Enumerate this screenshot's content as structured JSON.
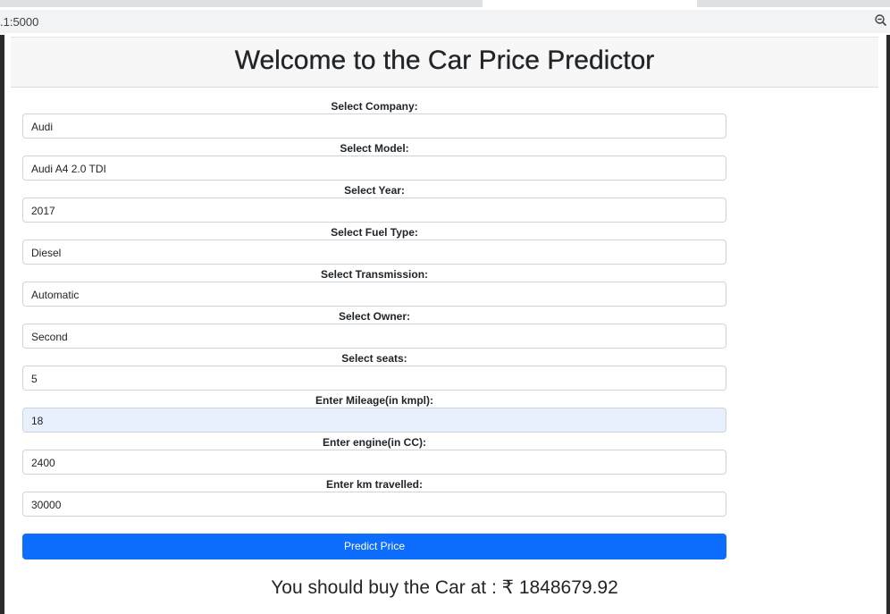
{
  "browser": {
    "url": ".1:5000",
    "zoom_icon": "zoom-out-icon"
  },
  "page": {
    "title": "Welcome to the Car Price Predictor"
  },
  "form": {
    "fields": [
      {
        "label": "Select Company:",
        "value": "Audi"
      },
      {
        "label": "Select Model:",
        "value": "Audi A4 2.0 TDI"
      },
      {
        "label": "Select Year:",
        "value": "2017"
      },
      {
        "label": "Select Fuel Type:",
        "value": "Diesel"
      },
      {
        "label": "Select Transmission:",
        "value": "Automatic"
      },
      {
        "label": "Select Owner:",
        "value": "Second"
      },
      {
        "label": "Select seats:",
        "value": "5"
      },
      {
        "label": "Enter Mileage(in kmpl):",
        "value": "18"
      },
      {
        "label": "Enter engine(in CC):",
        "value": "2400"
      },
      {
        "label": "Enter km travelled:",
        "value": "30000"
      }
    ],
    "submit_label": "Predict Price"
  },
  "result": {
    "text": "You should buy the Car at : ₹ 1848679.92"
  },
  "colors": {
    "primary_button": "#0d6efd",
    "autofill_background": "#e8f0fe",
    "header_background": "#f7f7f7"
  }
}
